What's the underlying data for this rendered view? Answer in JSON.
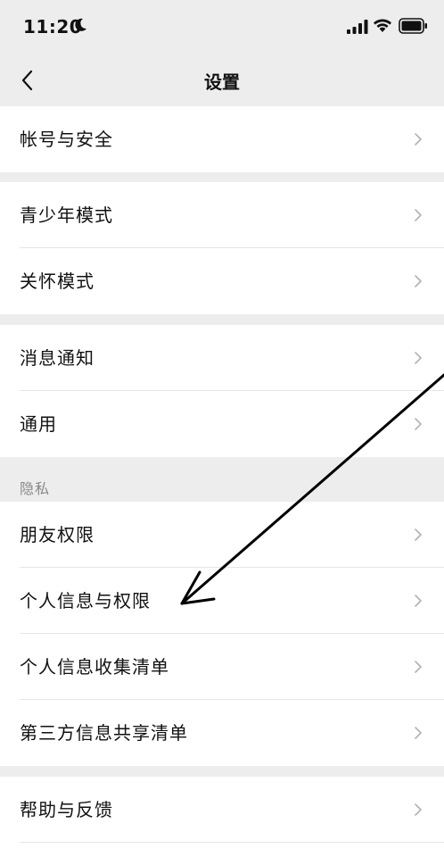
{
  "status_bar": {
    "time": "11:20"
  },
  "nav": {
    "title": "设置"
  },
  "groups": [
    {
      "items": [
        {
          "label": "帐号与安全"
        }
      ]
    },
    {
      "items": [
        {
          "label": "青少年模式"
        },
        {
          "label": "关怀模式"
        }
      ]
    },
    {
      "items": [
        {
          "label": "消息通知"
        },
        {
          "label": "通用"
        }
      ]
    },
    {
      "header": "隐私",
      "items": [
        {
          "label": "朋友权限"
        },
        {
          "label": "个人信息与权限"
        },
        {
          "label": "个人信息收集清单"
        },
        {
          "label": "第三方信息共享清单"
        }
      ]
    },
    {
      "items": [
        {
          "label": "帮助与反馈"
        }
      ]
    }
  ],
  "colors": {
    "background": "#ededed",
    "card": "#ffffff",
    "chevron": "#b2b2b2",
    "section_header": "#888888",
    "annotation": "#000000"
  }
}
